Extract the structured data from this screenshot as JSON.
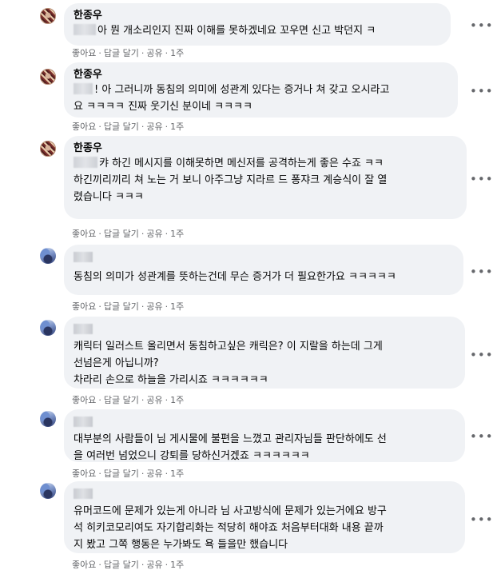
{
  "comments": [
    {
      "author": "한종우",
      "lines": [
        "아 뭔 개소리인지 진짜 이해를 못하겠네요 꼬우면 신고 박던지 ㅋ"
      ],
      "actions": {
        "like": "좋아요",
        "reply": "답글 달기",
        "share": "공유",
        "time": "1주"
      }
    },
    {
      "author": "한종우",
      "lines": [
        "! 아 그러니까 동침의 의미에 성관계 있다는 증거나 쳐 갖고 오시라고",
        "요 ㅋㅋㅋㅋ 진짜 웃기신 분이네 ㅋㅋㅋㅋ"
      ],
      "actions": {
        "like": "좋아요",
        "reply": "답글 달기",
        "share": "공유",
        "time": "1주"
      }
    },
    {
      "author": "한종우",
      "lines": [
        "캬 하긴 메시지를 이해못하면 메신저를 공격하는게 좋은 수죠 ㅋㅋ",
        "하긴끼리끼리 쳐 노는 거 보니 아주그냥 지라르 드 퐁쟈크 계승식이 잘 열",
        "렸습니다 ㅋㅋㅋ"
      ],
      "actions": {
        "like": "좋아요",
        "reply": "답글 달기",
        "share": "공유",
        "time": "1주"
      }
    },
    {
      "author": "",
      "lines": [
        "동침의 의미가 성관계를 뜻하는건데 무슨 증거가 더 필요한가요 ㅋㅋㅋㅋㅋ"
      ],
      "actions": {
        "like": "좋아요",
        "reply": "답글 달기",
        "share": "공유",
        "time": "1주"
      }
    },
    {
      "author": "",
      "lines": [
        "캐릭터 일러스트 올리면서 동침하고싶은 캐릭은? 이 지랄을 하는데 그게",
        "선넘은게 아닙니까?",
        "차라리 손으로 하늘을 가리시죠 ㅋㅋㅋㅋㅋㅋ"
      ],
      "actions": {
        "like": "좋아요",
        "reply": "답글 달기",
        "share": "공유",
        "time": "1주"
      }
    },
    {
      "author": "",
      "lines": [
        "대부분의 사람들이 님 게시물에 불편을 느꼈고 관리자님들 판단하에도 선",
        "을 여러번 넘었으니 강퇴를 당하신거겠죠 ㅋㅋㅋㅋㅋㅋ"
      ],
      "actions": {
        "like": "좋아요",
        "reply": "답글 달기",
        "share": "공유",
        "time": "1주"
      }
    },
    {
      "author": "",
      "lines": [
        "유머코드에 문제가 있는게 아니라 님 사고방식에 문제가 있는거에요 방구",
        "석 히키코모리여도 자기합리화는 적당히 해야죠 처음부터대화 내용 끝까",
        "지 봤고 그쪽 행동은 누가봐도 욕 들을만 했습니다"
      ],
      "actions": {
        "like": "좋아요",
        "reply": "답글 달기",
        "share": "공유",
        "time": "1주"
      }
    }
  ],
  "more_icon": "more-horizontal-icon",
  "colors": {
    "bubble": "#f0f2f5",
    "meta": "#65676b",
    "text": "#050505"
  }
}
